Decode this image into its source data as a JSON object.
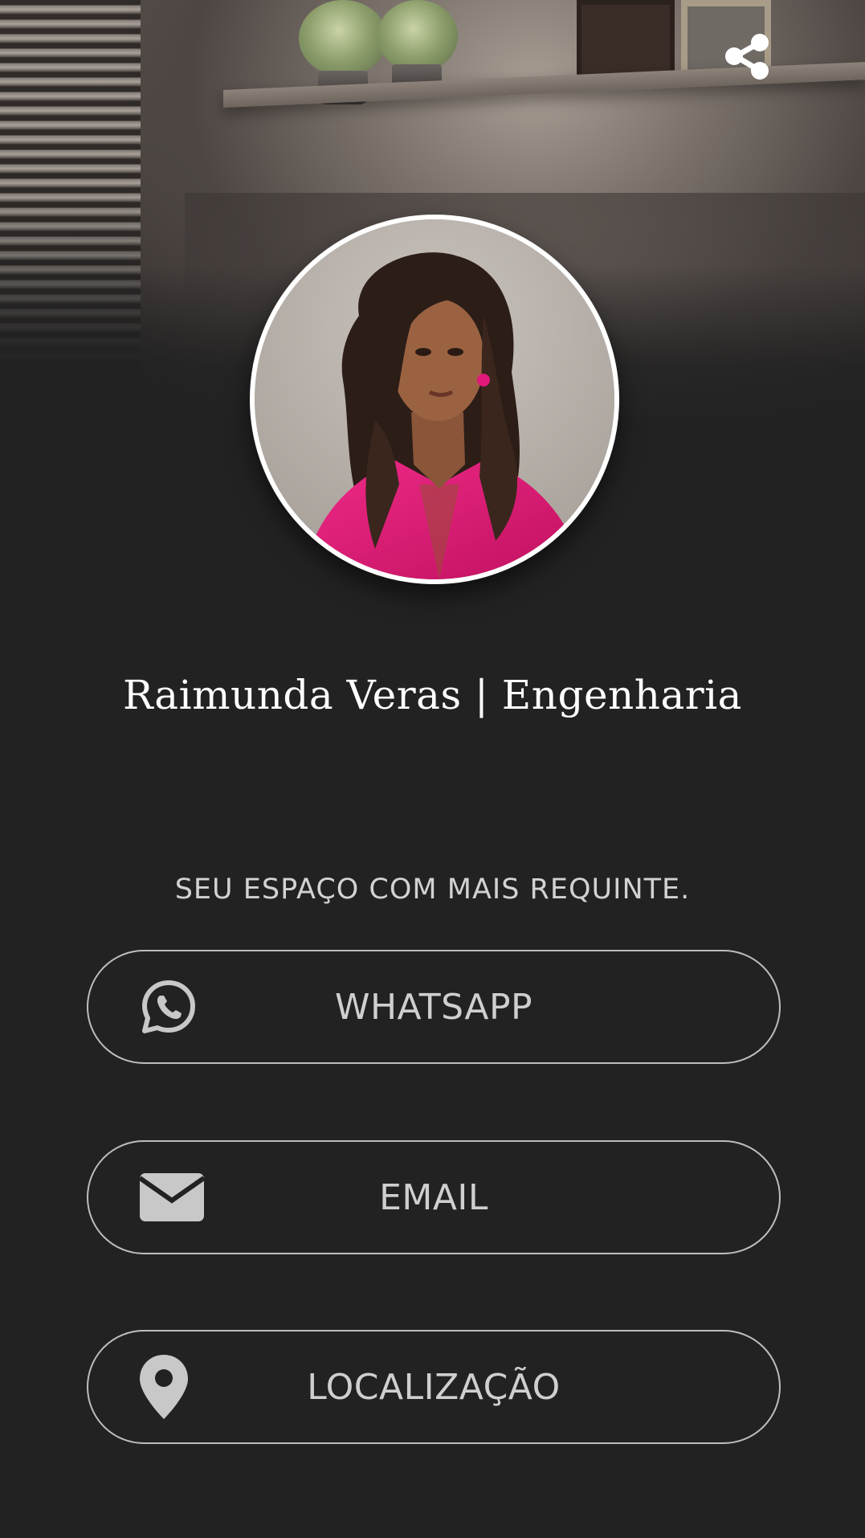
{
  "profile": {
    "name": "Raimunda Veras | Engenharia",
    "tagline": "SEU ESPAÇO COM MAIS REQUINTE."
  },
  "links": [
    {
      "label": "WHATSAPP",
      "icon": "whatsapp-icon"
    },
    {
      "label": "EMAIL",
      "icon": "envelope-icon"
    },
    {
      "label": "LOCALIZAÇÃO",
      "icon": "location-pin-icon"
    }
  ],
  "header": {
    "share_icon": "share-icon"
  },
  "colors": {
    "background": "#222222",
    "text": "#ffffff",
    "button_text": "#cfcfcf",
    "button_border": "#bdbdbd",
    "icon": "#c8c8c8",
    "avatar_border": "#ffffff",
    "shirt": "#e0187a"
  }
}
